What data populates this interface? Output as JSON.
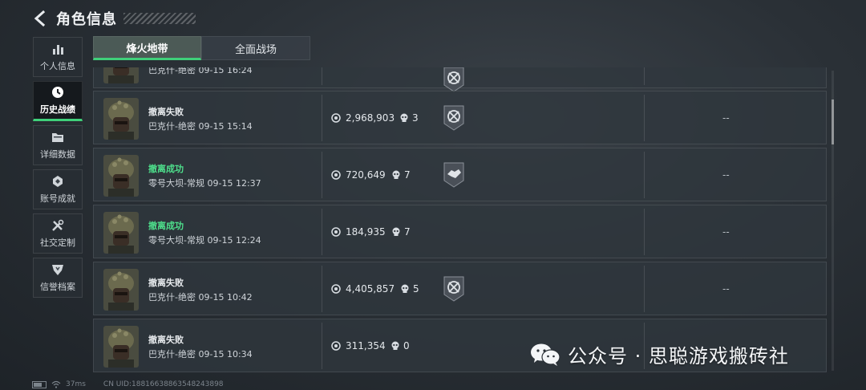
{
  "header": {
    "title": "角色信息",
    "back_icon": "arrow-left-icon"
  },
  "sidebar": {
    "items": [
      {
        "label": "个人信息",
        "icon": "bar-chart-icon",
        "active": false
      },
      {
        "label": "历史战绩",
        "icon": "clock-history-icon",
        "active": true
      },
      {
        "label": "详细数据",
        "icon": "folder-icon",
        "active": false
      },
      {
        "label": "账号成就",
        "icon": "achievement-medal-icon",
        "active": false
      },
      {
        "label": "社交定制",
        "icon": "tools-icon",
        "active": false
      },
      {
        "label": "信誉档案",
        "icon": "reputation-shield-icon",
        "active": false
      }
    ]
  },
  "tabs": [
    {
      "label": "烽火地带",
      "active": true
    },
    {
      "label": "全面战场",
      "active": false
    }
  ],
  "colors": {
    "accent": "#3fd07a",
    "success_text": "#4ee08c"
  },
  "records": [
    {
      "result": "",
      "map": "巴克什-绝密",
      "time": "09-15 16:24",
      "value": "",
      "kills": "",
      "badge": "cross-target-icon",
      "extra": "",
      "partial": true
    },
    {
      "result": "撤离失败",
      "map": "巴克什-绝密",
      "time": "09-15 15:14",
      "value": "2,968,903",
      "kills": "3",
      "badge": "cross-target-icon",
      "extra": "--",
      "success": false
    },
    {
      "result": "撤离成功",
      "map": "零号大坝-常规",
      "time": "09-15 12:37",
      "value": "720,649",
      "kills": "7",
      "badge": "handshake-icon",
      "extra": "--",
      "success": true
    },
    {
      "result": "撤离成功",
      "map": "零号大坝-常规",
      "time": "09-15 12:24",
      "value": "184,935",
      "kills": "7",
      "badge": "",
      "extra": "--",
      "success": true
    },
    {
      "result": "撤离失败",
      "map": "巴克什-绝密",
      "time": "09-15 10:42",
      "value": "4,405,857",
      "kills": "5",
      "badge": "cross-target-icon",
      "extra": "--",
      "success": false
    },
    {
      "result": "撤离失败",
      "map": "巴克什-绝密",
      "time": "09-15 10:34",
      "value": "311,354",
      "kills": "0",
      "badge": "",
      "extra": "",
      "success": false
    }
  ],
  "status": {
    "ping": "37ms",
    "uid": "CN UID:18816638863548243898"
  },
  "watermark": {
    "text": "公众号 · 思聪游戏搬砖社",
    "icon": "wechat-icon"
  }
}
